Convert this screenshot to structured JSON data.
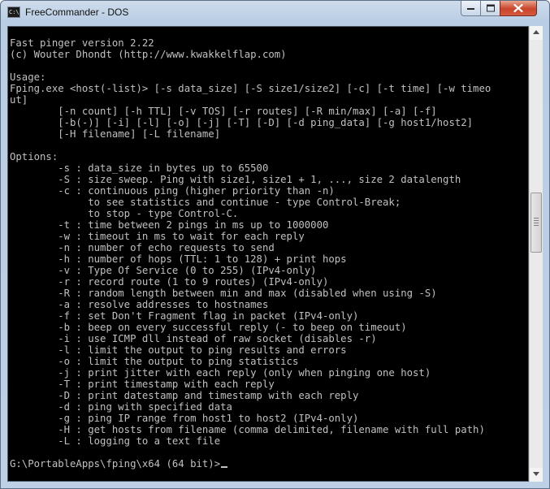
{
  "window": {
    "title": "FreeCommander - DOS",
    "icon": "console-icon",
    "icon_text": "C:\\",
    "buttons": [
      "minimize-icon",
      "maximize-icon",
      "close-icon"
    ]
  },
  "console": {
    "lines": [
      "Fast pinger version 2.22",
      "(c) Wouter Dhondt (http://www.kwakkelflap.com)",
      "",
      "Usage:",
      "Fping.exe <host(-list)> [-s data_size] [-S size1/size2] [-c] [-t time] [-w timeo",
      "ut]",
      "        [-n count] [-h TTL] [-v TOS] [-r routes] [-R min/max] [-a] [-f]",
      "        [-b(-)] [-i] [-l] [-o] [-j] [-T] [-D] [-d ping_data] [-g host1/host2]",
      "        [-H filename] [-L filename]",
      "",
      "Options:",
      "        -s : data_size in bytes up to 65500",
      "        -S : size sweep. Ping with size1, size1 + 1, ..., size 2 datalength",
      "        -c : continuous ping (higher priority than -n)",
      "             to see statistics and continue - type Control-Break;",
      "             to stop - type Control-C.",
      "        -t : time between 2 pings in ms up to 1000000",
      "        -w : timeout in ms to wait for each reply",
      "        -n : number of echo requests to send",
      "        -h : number of hops (TTL: 1 to 128) + print hops",
      "        -v : Type Of Service (0 to 255) (IPv4-only)",
      "        -r : record route (1 to 9 routes) (IPv4-only)",
      "        -R : random length between min and max (disabled when using -S)",
      "        -a : resolve addresses to hostnames",
      "        -f : set Don't Fragment flag in packet (IPv4-only)",
      "        -b : beep on every successful reply (- to beep on timeout)",
      "        -i : use ICMP dll instead of raw socket (disables -r)",
      "        -l : limit the output to ping results and errors",
      "        -o : limit the output to ping statistics",
      "        -j : print jitter with each reply (only when pinging one host)",
      "        -T : print timestamp with each reply",
      "        -D : print datestamp and timestamp with each reply",
      "        -d : ping with specified data",
      "        -g : ping IP range from host1 to host2 (IPv4-only)",
      "        -H : get hosts from filename (comma delimited, filename with full path)",
      "        -L : logging to a text file",
      ""
    ],
    "prompt": "G:\\PortableApps\\fping\\x64 (64 bit)>",
    "text_color": "#c0c0c0",
    "background_color": "#000000"
  },
  "scrollbar": {
    "up_icon": "scroll-up-arrow-icon",
    "down_icon": "scroll-down-arrow-icon"
  }
}
